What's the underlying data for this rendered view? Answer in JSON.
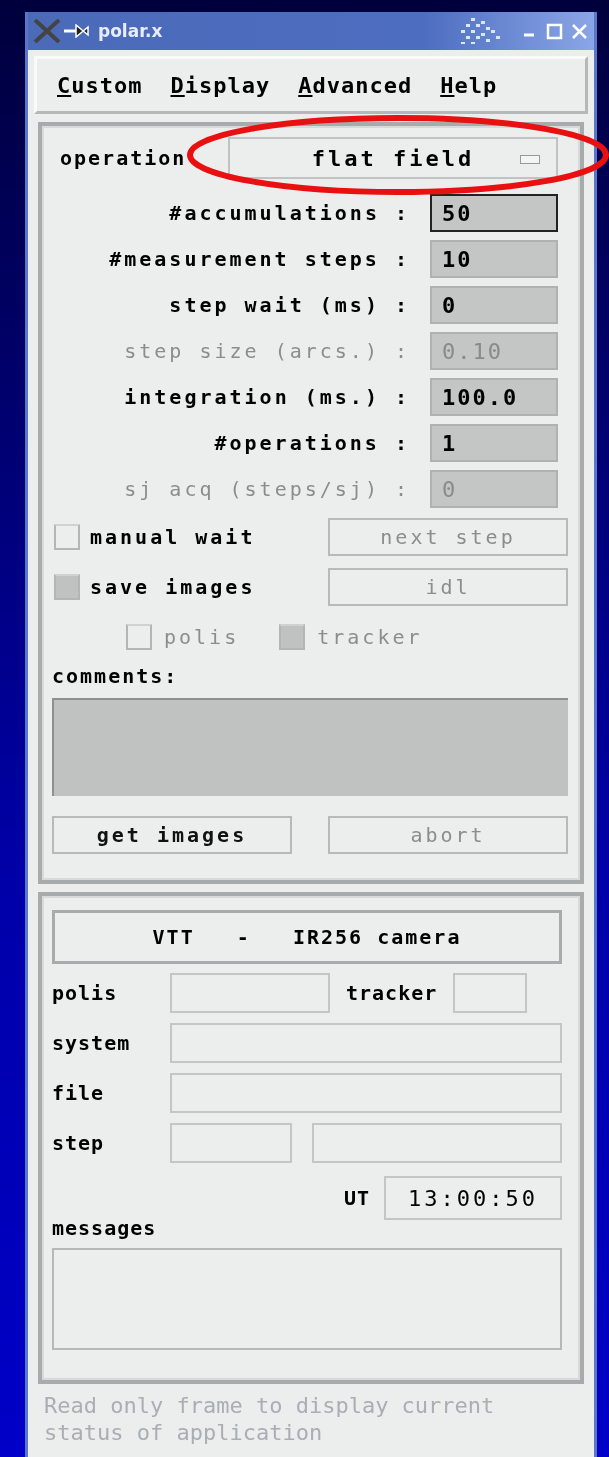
{
  "window": {
    "title": "polar.x"
  },
  "menu": [
    {
      "label": "Custom"
    },
    {
      "label": "Display"
    },
    {
      "label": "Advanced"
    },
    {
      "label": "Help"
    }
  ],
  "operation": {
    "label": "operation",
    "value": "flat field"
  },
  "params": [
    {
      "label": "#accumulations :",
      "value": "50",
      "disabled": false,
      "focused": true
    },
    {
      "label": "#measurement steps :",
      "value": "10",
      "disabled": false,
      "focused": false
    },
    {
      "label": "step wait (ms) :",
      "value": "0",
      "disabled": false,
      "focused": false
    },
    {
      "label": "step size (arcs.) :",
      "value": "0.10",
      "disabled": true,
      "focused": false
    },
    {
      "label": "integration (ms.) :",
      "value": "100.0",
      "disabled": false,
      "focused": false
    },
    {
      "label": "#operations :",
      "value": "1",
      "disabled": false,
      "focused": false
    },
    {
      "label": "sj acq (steps/sj) :",
      "value": "0",
      "disabled": true,
      "focused": false
    }
  ],
  "options": [
    {
      "label": "manual wait",
      "checked": false,
      "button": {
        "label": "next step",
        "disabled": true
      }
    },
    {
      "label": "save images",
      "checked": true,
      "button": {
        "label": "idl",
        "disabled": true
      }
    }
  ],
  "sub_options": [
    {
      "label": "polis",
      "checked": false,
      "disabled": true
    },
    {
      "label": "tracker",
      "checked": true,
      "disabled": true
    }
  ],
  "comments": {
    "label": "comments:"
  },
  "actions": [
    {
      "label": "get images",
      "disabled": false
    },
    {
      "label": "abort",
      "disabled": true
    }
  ],
  "status": {
    "title": "VTT   -   IR256 camera",
    "polis": {
      "label": "polis"
    },
    "tracker": {
      "label": "tracker"
    },
    "system": {
      "label": "system"
    },
    "file": {
      "label": "file"
    },
    "step": {
      "label": "step"
    },
    "ut": {
      "label": "UT",
      "value": "13:00:50"
    },
    "messages": {
      "label": "messages"
    }
  },
  "footer": {
    "text": "Read only frame to display current status of application"
  }
}
